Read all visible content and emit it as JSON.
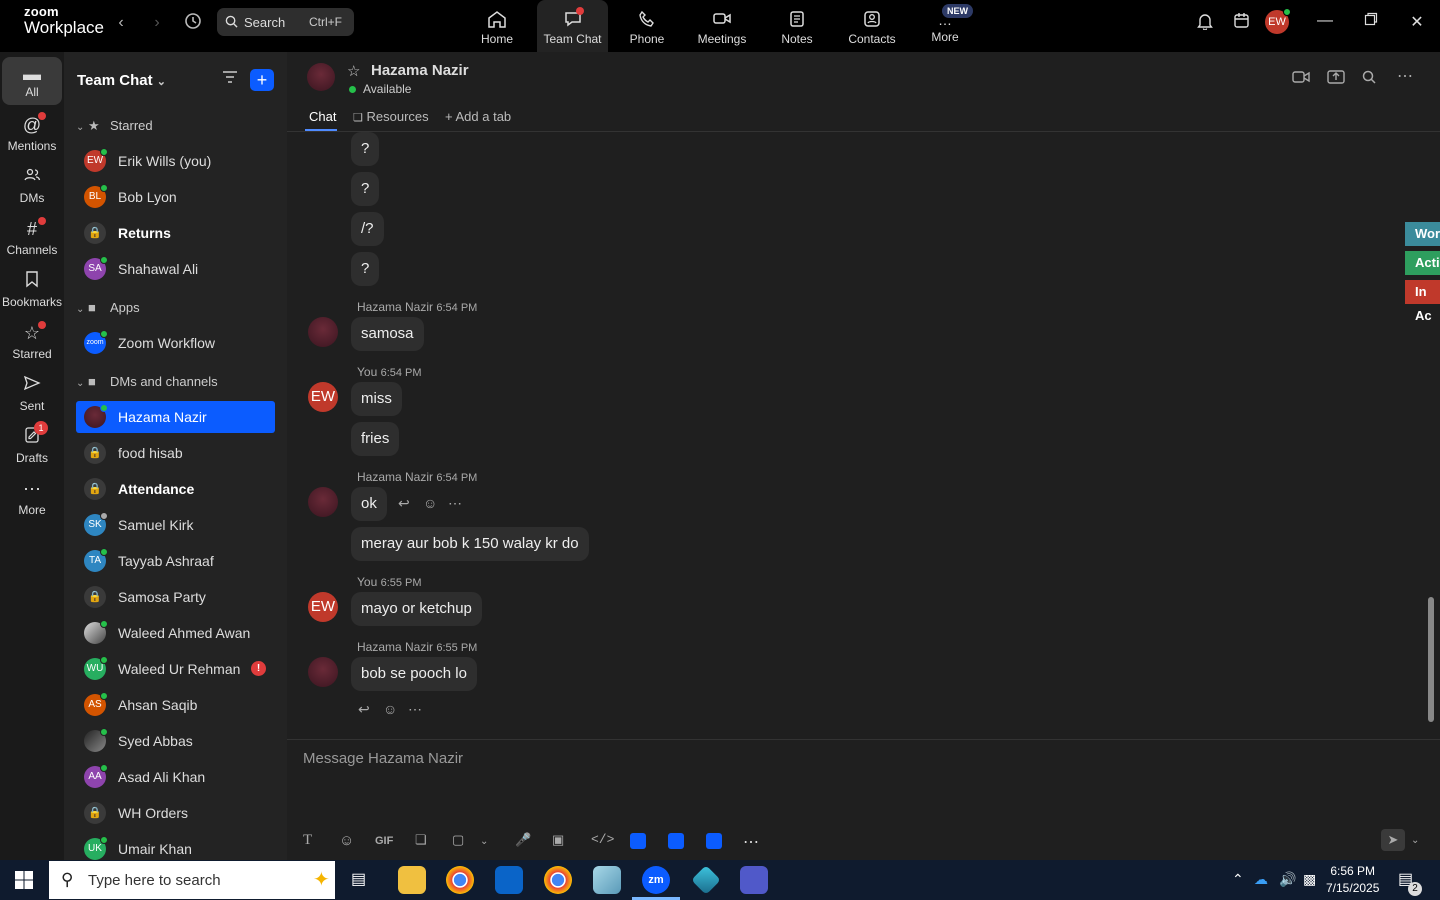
{
  "app": {
    "logo_line1": "zoom",
    "logo_line2": "Workplace"
  },
  "search": {
    "label": "Search",
    "shortcut": "Ctrl+F"
  },
  "nav": [
    {
      "label": "Home",
      "icon": "home-icon"
    },
    {
      "label": "Team Chat",
      "icon": "chat-icon"
    },
    {
      "label": "Phone",
      "icon": "phone-icon"
    },
    {
      "label": "Meetings",
      "icon": "video-icon"
    },
    {
      "label": "Notes",
      "icon": "notes-icon"
    },
    {
      "label": "Contacts",
      "icon": "contacts-icon"
    },
    {
      "label": "More",
      "icon": "more-icon"
    }
  ],
  "new_badge": "NEW",
  "user_initials": "EW",
  "rail": [
    {
      "label": "All"
    },
    {
      "label": "Mentions"
    },
    {
      "label": "DMs"
    },
    {
      "label": "Channels"
    },
    {
      "label": "Bookmarks"
    },
    {
      "label": "Starred"
    },
    {
      "label": "Sent"
    },
    {
      "label": "Drafts",
      "badge": "1"
    },
    {
      "label": "More"
    }
  ],
  "sidebar": {
    "title": "Team Chat",
    "sections": {
      "starred": "Starred",
      "apps": "Apps",
      "dms": "DMs and channels"
    },
    "starred": [
      {
        "name": "Erik Wills (you)",
        "initials": "EW",
        "color": "#c0392b"
      },
      {
        "name": "Bob Lyon",
        "initials": "BL",
        "color": "#d35400"
      },
      {
        "name": "Returns",
        "channel": true
      },
      {
        "name": "Shahawal Ali",
        "initials": "SA",
        "color": "#8e44ad"
      }
    ],
    "apps": [
      {
        "name": "Zoom Workflow",
        "initials": "zoom",
        "color": "#0b5cff"
      }
    ],
    "dms": [
      {
        "name": "Hazama Nazir"
      },
      {
        "name": "food hisab",
        "channel": true
      },
      {
        "name": "Attendance",
        "channel": true
      },
      {
        "name": "Samuel Kirk",
        "initials": "SK",
        "color": "#2e86c1"
      },
      {
        "name": "Tayyab Ashraaf",
        "initials": "TA",
        "color": "#2e86c1"
      },
      {
        "name": "Samosa Party",
        "channel": true
      },
      {
        "name": "Waleed Ahmed Awan",
        "initials": "",
        "color": "#555"
      },
      {
        "name": "Waleed Ur Rehman",
        "initials": "WU",
        "color": "#27ae60",
        "alert": "!"
      },
      {
        "name": "Ahsan Saqib",
        "initials": "AS",
        "color": "#d35400"
      },
      {
        "name": "Syed Abbas",
        "initials": "",
        "color": "#444"
      },
      {
        "name": "Asad Ali Khan",
        "initials": "AA",
        "color": "#8e44ad"
      },
      {
        "name": "WH Orders",
        "channel": true
      },
      {
        "name": "Umair Khan",
        "initials": "UK",
        "color": "#27ae60"
      }
    ]
  },
  "chat": {
    "name": "Hazama Nazir",
    "status": "Available",
    "tabs": [
      "Chat",
      "Resources",
      "Add a tab"
    ],
    "messages": [
      {
        "text": "?"
      },
      {
        "text": "?"
      },
      {
        "text": "/?"
      },
      {
        "text": "?"
      },
      {
        "sender": "Hazama Nazir",
        "time": "6:54 PM",
        "text": "samosa"
      },
      {
        "sender": "You",
        "time": "6:54 PM",
        "text": "miss"
      },
      {
        "text": "fries"
      },
      {
        "sender": "Hazama Nazir",
        "time": "6:54 PM",
        "text": "ok"
      },
      {
        "text": "meray aur bob k 150 walay kr do"
      },
      {
        "sender": "You",
        "time": "6:55 PM",
        "text": "mayo or ketchup"
      },
      {
        "sender": "Hazama Nazir",
        "time": "6:55 PM",
        "text": "bob se pooch lo"
      }
    ],
    "right_tabs": [
      {
        "label": "Wor",
        "color": "#3b8b9b"
      },
      {
        "label": "Acti",
        "color": "#2e9e5e"
      },
      {
        "label": "In Ac",
        "color": "#c0392b"
      }
    ],
    "compose_placeholder": "Message Hazama Nazir",
    "toolbar": {
      "gif": "GIF"
    }
  },
  "taskbar": {
    "search_placeholder": "Type here to search",
    "time": "6:56 PM",
    "date": "7/15/2025",
    "notif_count": "2"
  }
}
